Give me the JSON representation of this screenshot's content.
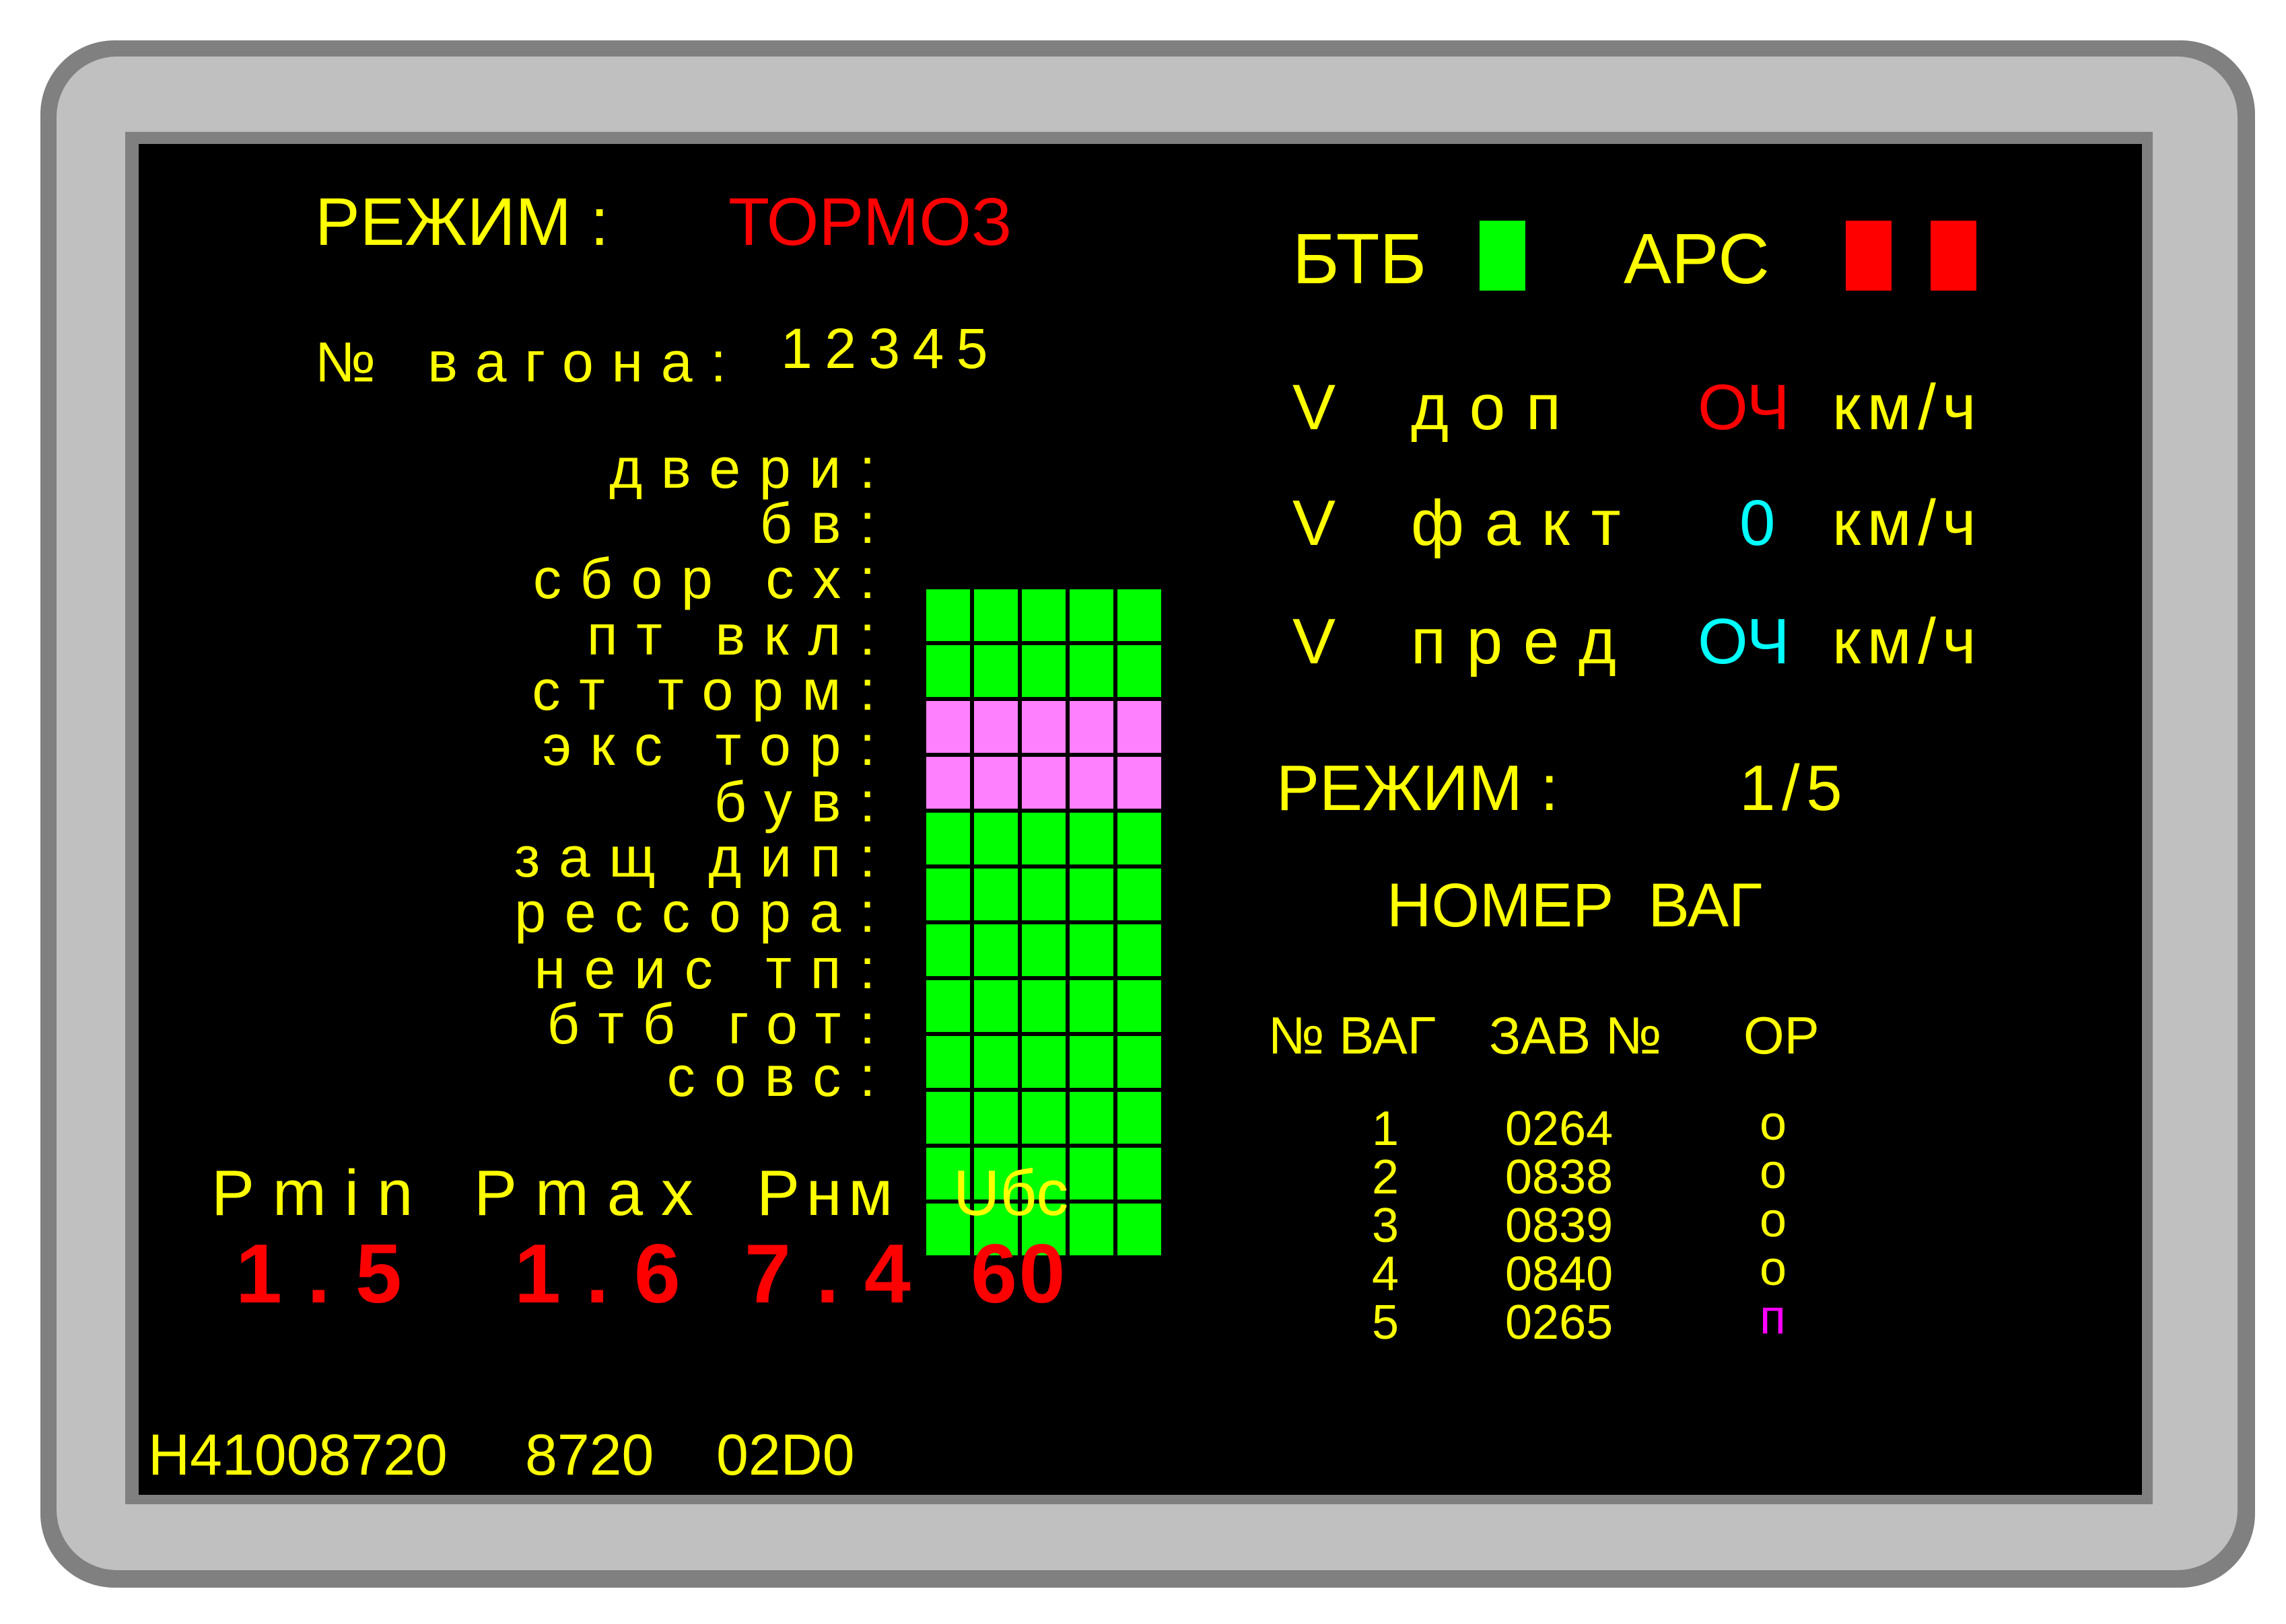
{
  "left": {
    "mode_label": "РЕЖИМ :",
    "mode_value": "ТОРМОЗ",
    "wagon_label": "№ вагона:",
    "wagon_numbers": "12345",
    "status_rows": [
      {
        "label": "двери:",
        "state": "ok"
      },
      {
        "label": "бв:",
        "state": "ok"
      },
      {
        "label": "сбор сх:",
        "state": "active"
      },
      {
        "label": "пт вкл:",
        "state": "active"
      },
      {
        "label": "ст торм:",
        "state": "ok"
      },
      {
        "label": "экс тор:",
        "state": "ok"
      },
      {
        "label": "був:",
        "state": "ok"
      },
      {
        "label": "защ дип:",
        "state": "ok"
      },
      {
        "label": "рессора:",
        "state": "ok"
      },
      {
        "label": "неис тп:",
        "state": "ok"
      },
      {
        "label": "бтб гот:",
        "state": "ok"
      },
      {
        "label": "совс:",
        "state": "ok"
      }
    ],
    "pressures": {
      "pmin_label": "Pmin",
      "pmin_value": "1.5",
      "pmax_label": "Pmax",
      "pmax_value": "1.6",
      "pnm_label": "Pнм",
      "pnm_value": "7.4",
      "ubc_label": "Uбс",
      "ubc_value": "60"
    }
  },
  "right": {
    "btb_label": "БТБ",
    "btb_indicator": "green",
    "ars_label": "АРС",
    "ars_indicators": [
      "red",
      "red"
    ],
    "speeds": [
      {
        "v": "V",
        "label": "доп",
        "value": "ОЧ",
        "value_color": "#ff0000",
        "unit": "км/ч"
      },
      {
        "v": "V",
        "label": "факт",
        "value": "0",
        "value_color": "#00ffff",
        "unit": "км/ч"
      },
      {
        "v": "V",
        "label": "пред",
        "value": "ОЧ",
        "value_color": "#00ffff",
        "unit": "км/ч"
      }
    ],
    "mode_label": "РЕЖИМ :",
    "mode_value": "1/5",
    "wagon_title": "НОМЕР  ВАГ",
    "table_headers": [
      "№ ВАГ",
      "ЗАВ №",
      "ОР"
    ],
    "wagons": [
      {
        "num": "1",
        "zav": "0264",
        "or": "о"
      },
      {
        "num": "2",
        "zav": "0838",
        "or": "о"
      },
      {
        "num": "3",
        "zav": "0839",
        "or": "о"
      },
      {
        "num": "4",
        "zav": "0840",
        "or": "о"
      },
      {
        "num": "5",
        "zav": "0265",
        "or": "п"
      }
    ]
  },
  "footer": {
    "id": "H41008720",
    "code1": "8720",
    "code2": "02D0"
  },
  "colors": {
    "ok": "#00ff00",
    "active": "#ff80ff",
    "text": "#ffff00",
    "alert": "#ff0000",
    "info": "#00ffff",
    "pending": "#ff00ff"
  }
}
